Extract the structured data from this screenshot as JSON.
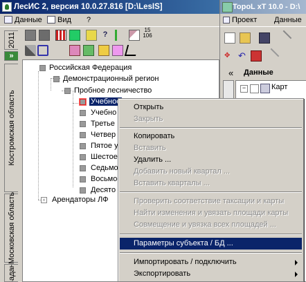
{
  "main_window": {
    "title": "ЛесИС 2, версия 10.0.27.816  [D:\\LesIS]",
    "menu": {
      "data": "Данные",
      "view": "Вид",
      "help": "?"
    },
    "toolbar_row1": {
      "badge_top": "15",
      "badge_bottom": "106"
    }
  },
  "side_tabs": {
    "year": "2011",
    "region1": "Костромская область",
    "region2": "Московская область",
    "region3": "Задан"
  },
  "tree": {
    "root": "Российская Федерация",
    "demo_region": "Демонстрационный регион",
    "forestry": "Пробное лесничество",
    "children": [
      "Учебно",
      "Учебно",
      "Третье",
      "Четвер",
      "Пятое у",
      "Шестое",
      "Седьмо",
      "Восьмое",
      "Десято"
    ],
    "tenants": "Арендаторы ЛФ",
    "selected_label": "Учебное"
  },
  "right_window": {
    "title": "TopoL xT 10.0 - D:\\",
    "menu": {
      "project": "Проект",
      "data": "Данные"
    },
    "collapse": "«",
    "panel_title": "Данные",
    "tree_item": "Карт"
  },
  "context_menu": {
    "items": [
      {
        "label": "Открыть",
        "enabled": true
      },
      {
        "label": "Закрыть",
        "enabled": false
      },
      {
        "label": "Копировать",
        "enabled": true
      },
      {
        "label": "Вставить",
        "enabled": false
      },
      {
        "label": "Удалить ...",
        "enabled": true
      },
      {
        "label": "Добавить новый квартал ...",
        "enabled": false
      },
      {
        "label": "Вставить кварталы ...",
        "enabled": false
      },
      {
        "label": "Проверить соответствие таксации и карты",
        "enabled": false
      },
      {
        "label": "Найти изменения и увязать площади карты",
        "enabled": false
      },
      {
        "label": "Совмещение и увязка всех площадей ...",
        "enabled": false
      },
      {
        "label": "Параметры субъекта / БД ...",
        "enabled": true,
        "selected": true
      },
      {
        "label": "Импортировать / подключить",
        "enabled": true,
        "submenu": true
      },
      {
        "label": "Экспортировать",
        "enabled": true,
        "submenu": true
      }
    ]
  },
  "colors": {
    "title_active": "#0a246a",
    "selection": "#0a246a",
    "face": "#d4d0c8"
  }
}
